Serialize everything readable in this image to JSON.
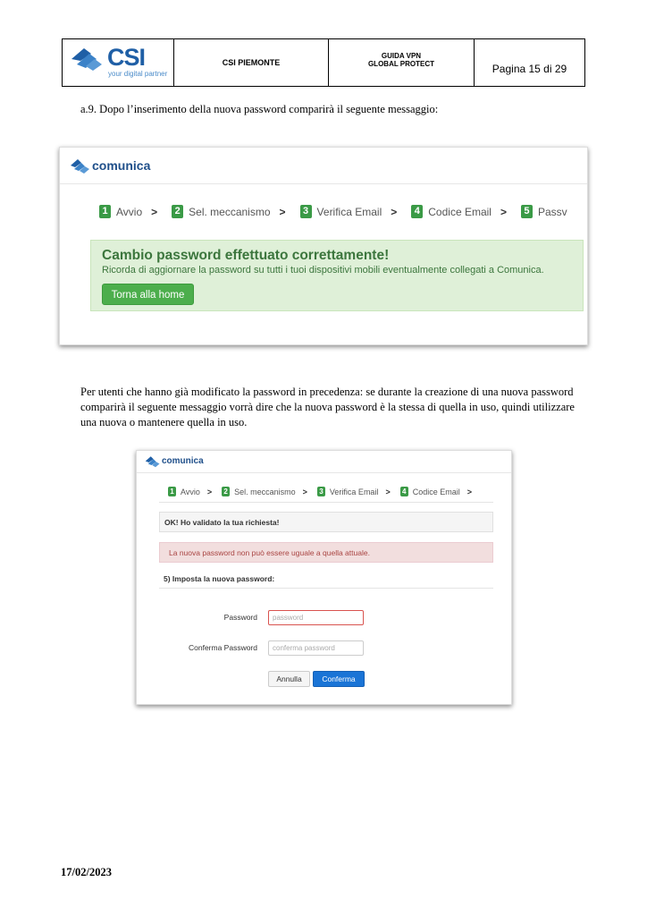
{
  "header": {
    "logo_text": "CSI",
    "logo_tagline": "your digital partner",
    "org": "CSI PIEMONTE",
    "guide_line1": "GUIDA VPN",
    "guide_line2": "GLOBAL PROTECT",
    "page": "Pagina 15 di 29"
  },
  "step_a9": "a.9.  Dopo l’inserimento della nuova password comparirà il seguente messaggio:",
  "screenshot1": {
    "brand": "comunica",
    "steps": [
      {
        "num": "1",
        "label": "Avvio"
      },
      {
        "num": "2",
        "label": "Sel. meccanismo"
      },
      {
        "num": "3",
        "label": "Verifica Email"
      },
      {
        "num": "4",
        "label": "Codice Email"
      },
      {
        "num": "5",
        "label": "Passv"
      }
    ],
    "alert_title": "Cambio password effettuato correttamente!",
    "alert_message": "Ricorda di aggiornare la password su tutti i tuoi dispositivi mobili eventualmente collegati a Comunica.",
    "home_button": "Torna alla home"
  },
  "paragraph": "Per utenti che hanno già modificato la password in precedenza: se durante la creazione di una nuova password comparirà il seguente messaggio vorrà dire che la nuova password è la stessa di quella in uso, quindi utilizzare una nuova o mantenere quella in uso.",
  "screenshot2": {
    "brand": "comunica",
    "steps": [
      {
        "num": "1",
        "label": "Avvio"
      },
      {
        "num": "2",
        "label": "Sel. meccanismo"
      },
      {
        "num": "3",
        "label": "Verifica Email"
      },
      {
        "num": "4",
        "label": "Codice Email"
      }
    ],
    "ok_message": "OK! Ho validato la tua richiesta!",
    "error_message": "La nuova password non può essere uguale a quella attuale.",
    "section_label": "5) Imposta la nuova password:",
    "password_label": "Password",
    "password_placeholder": "password",
    "confirm_label": "Conferma Password",
    "confirm_placeholder": "conferma password",
    "cancel_button": "Annulla",
    "confirm_button": "Conferma"
  },
  "footer_date": "17/02/2023",
  "colors": {
    "brand_blue": "#1f5fa6",
    "success_green": "#3a9a46",
    "confirm_blue": "#1a74d6",
    "error_red": "#a94442"
  }
}
